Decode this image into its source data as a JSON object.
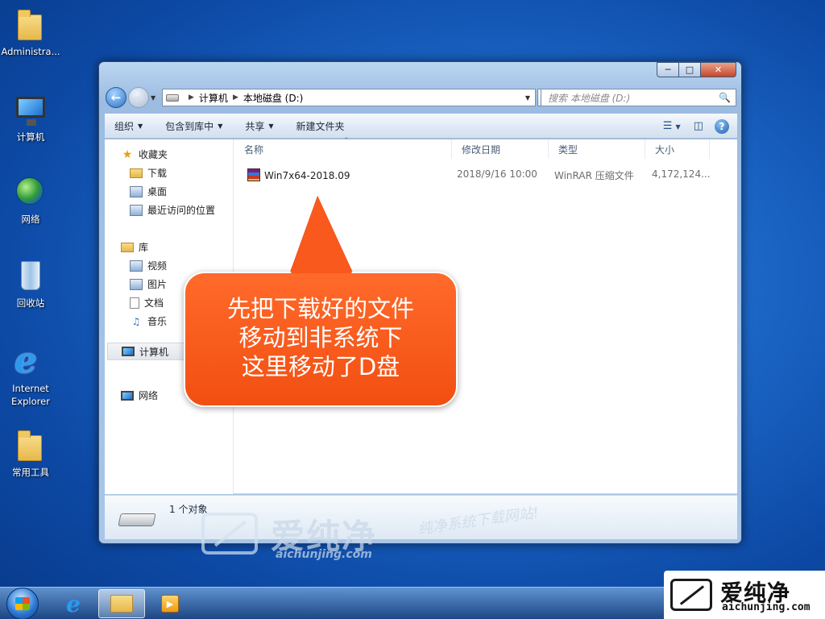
{
  "desktop": {
    "icons": [
      {
        "label": "Administra...",
        "icon": "user-folder-icon"
      },
      {
        "label": "计算机",
        "icon": "computer-icon"
      },
      {
        "label": "网络",
        "icon": "network-icon"
      },
      {
        "label": "回收站",
        "icon": "recycle-bin-icon"
      },
      {
        "label": "Internet Explorer",
        "icon": "ie-icon"
      },
      {
        "label": "常用工具",
        "icon": "folder-icon"
      }
    ]
  },
  "explorer": {
    "controls": {
      "minimize": "─",
      "maximize": "□",
      "close": "✕"
    },
    "breadcrumb": [
      "计算机",
      "本地磁盘 (D:)"
    ],
    "search_placeholder": "搜索 本地磁盘 (D:)",
    "toolbar": {
      "organize": "组织",
      "include_in_library": "包含到库中",
      "share": "共享",
      "new_folder": "新建文件夹"
    },
    "nav": {
      "favorites": "收藏夹",
      "downloads": "下载",
      "desktop": "桌面",
      "recent": "最近访问的位置",
      "libraries": "库",
      "videos": "视频",
      "pictures": "图片",
      "documents": "文档",
      "music": "音乐",
      "computer": "计算机",
      "network": "网络"
    },
    "columns": {
      "name": "名称",
      "modified": "修改日期",
      "type": "类型",
      "size": "大小"
    },
    "files": [
      {
        "name": "Win7x64-2018.09",
        "modified": "2018/9/16 10:00",
        "type": "WinRAR 压缩文件",
        "size": "4,172,124..."
      }
    ],
    "status": "1 个对象"
  },
  "callout": {
    "lines": [
      "先把下载好的文件",
      "移动到非系统下",
      "这里移动了D盘"
    ],
    "color": "#f4561a"
  },
  "watermark": {
    "name": "爱纯净",
    "url": "aichunjing.com",
    "slogan": "纯净系统下载网站!"
  },
  "brand": {
    "name": "爱纯净",
    "url": "aichunjing.com"
  }
}
